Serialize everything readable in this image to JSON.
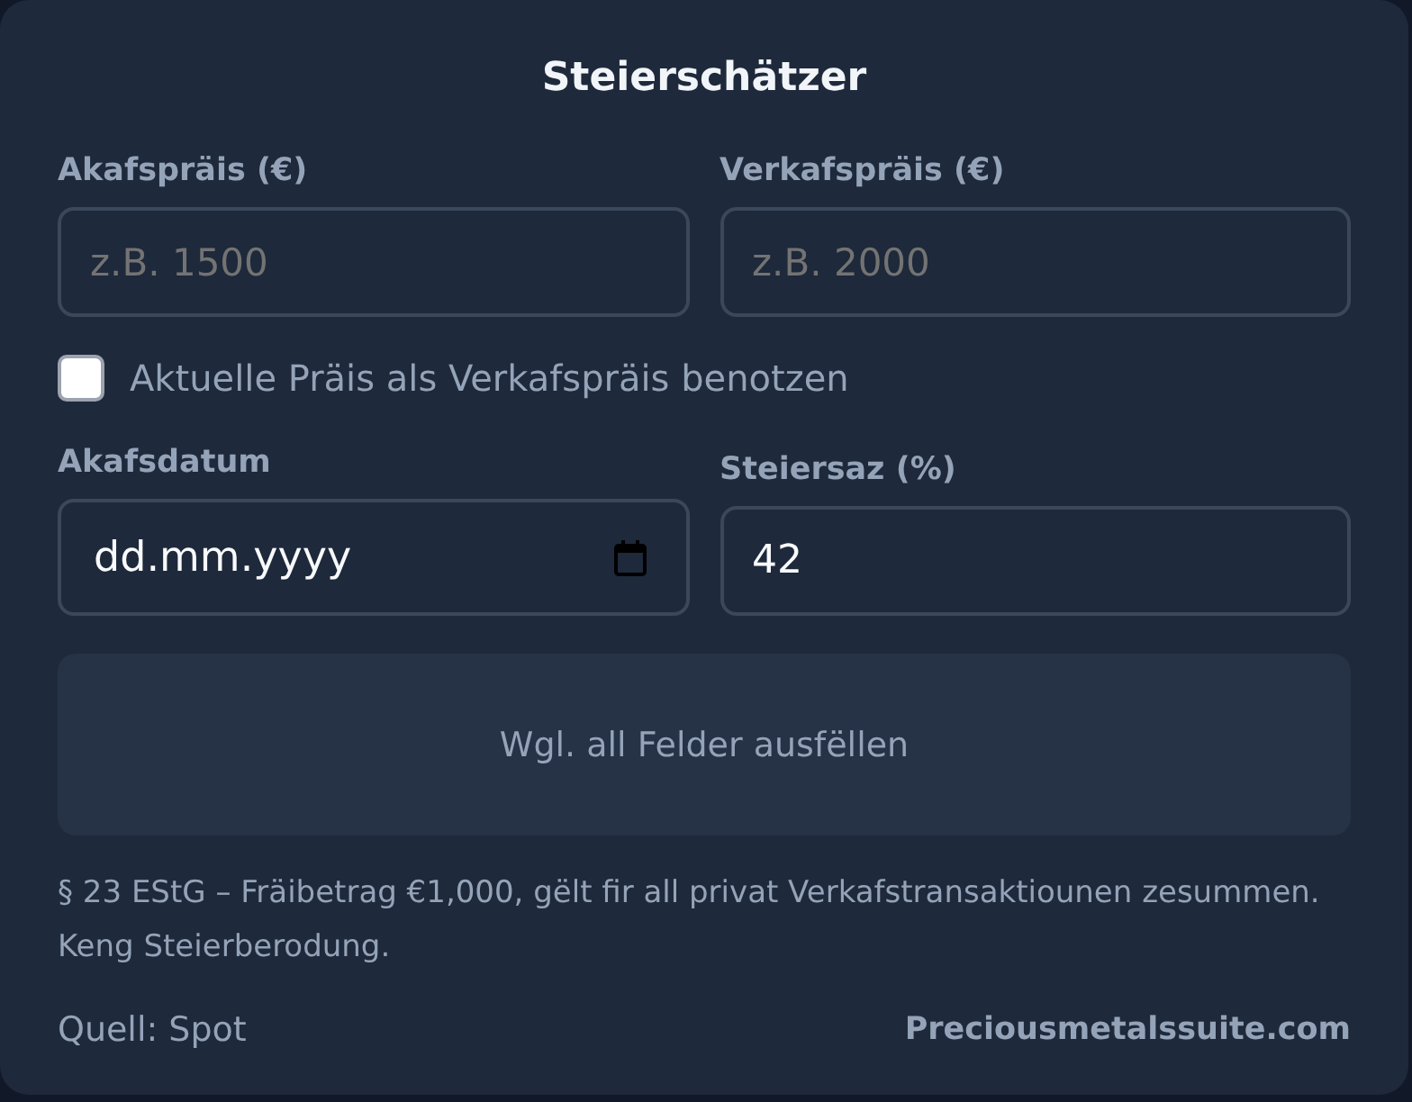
{
  "title": "Steierschätzer",
  "price_fields": [
    {
      "kind": "number",
      "label": "Akafspräis (€)",
      "placeholder": "z.B. 1500"
    },
    {
      "kind": "number",
      "label": "Verkafspräis (€)",
      "placeholder": "z.B. 2000"
    }
  ],
  "use_current_price": {
    "label": "Aktuelle Präis als Verkafspräis benotzen",
    "checked": false
  },
  "detail_fields": [
    {
      "kind": "date",
      "label": "Akafsdatum",
      "placeholder": "dd.mm.yyyy"
    },
    {
      "kind": "number",
      "label": "Steiersaz (%)",
      "value": "42"
    }
  ],
  "result": {
    "message": "Wgl. all Felder ausfëllen"
  },
  "note": "§ 23 EStG – Fräibetrag €1,000, gëlt fir all privat Verkafstransaktiounen zesummen. Keng Steierberodung.",
  "footer": {
    "source": "Quell: Spot",
    "link": "Preciousmetalssuite.com"
  }
}
